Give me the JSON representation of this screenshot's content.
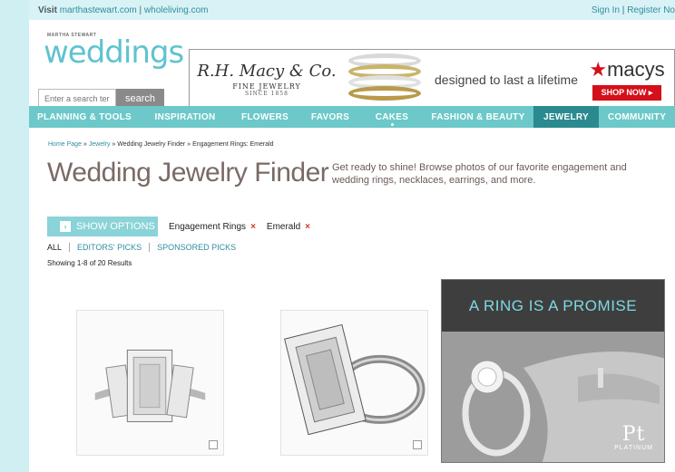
{
  "topbar": {
    "visit_label": "Visit",
    "visit_link1": "marthastewart.com",
    "visit_sep": " | ",
    "visit_link2": "wholeliving.com",
    "signin": "Sign In",
    "sep": " | ",
    "register": "Register No"
  },
  "header": {
    "logo_small": "MARTHA STEWART",
    "logo": "weddings",
    "search_placeholder": "Enter a search term",
    "search_button": "search"
  },
  "ad_banner": {
    "brand_script": "R.H. Macy & Co.",
    "brand_line": "FINE JEWELRY",
    "brand_since": "SINCE 1858",
    "tagline": "designed to last a lifetime",
    "logo": "macys",
    "star": "★",
    "cta": "SHOP NOW ▸",
    "colors": {
      "red": "#d4101a"
    }
  },
  "nav": {
    "items": [
      {
        "label": "PLANNING & TOOLS"
      },
      {
        "label": "INSPIRATION"
      },
      {
        "label": "FLOWERS"
      },
      {
        "label": "FAVORS"
      },
      {
        "label": "CAKES"
      },
      {
        "label": "FASHION & BEAUTY"
      },
      {
        "label": "JEWELRY"
      },
      {
        "label": "COMMUNITY"
      }
    ],
    "active": "JEWELRY",
    "colors": {
      "bar": "#6cc8c9",
      "active": "#2a8a8f"
    }
  },
  "breadcrumb": {
    "home": "Home Page",
    "sep": " » ",
    "jewelry": "Jewelry",
    "finder": "Wedding Jewelry Finder",
    "current": "Engagement Rings: Emerald"
  },
  "page": {
    "title": "Wedding Jewelry Finder",
    "tagline": "Get ready to shine! Browse photos of our favorite engagement and wedding rings, necklaces, earrings, and more."
  },
  "filters": {
    "show_options": "SHOW OPTIONS",
    "arrow": "›",
    "chips": [
      {
        "label": "Engagement Rings",
        "remove": "×"
      },
      {
        "label": "Emerald",
        "remove": "×"
      }
    ]
  },
  "tabs": [
    {
      "label": "ALL"
    },
    {
      "label": "EDITORS' PICKS"
    },
    {
      "label": "SPONSORED PICKS"
    }
  ],
  "results": "Showing 1-8 of 20 Results",
  "promo_ad": {
    "headline": "A RING IS A PROMISE",
    "logo_mark": "Pt",
    "logo_text": "PLATINUM"
  },
  "icons": {
    "zoom": "zoom-icon",
    "remove": "close-icon",
    "arrow": "chevron-right-icon"
  }
}
